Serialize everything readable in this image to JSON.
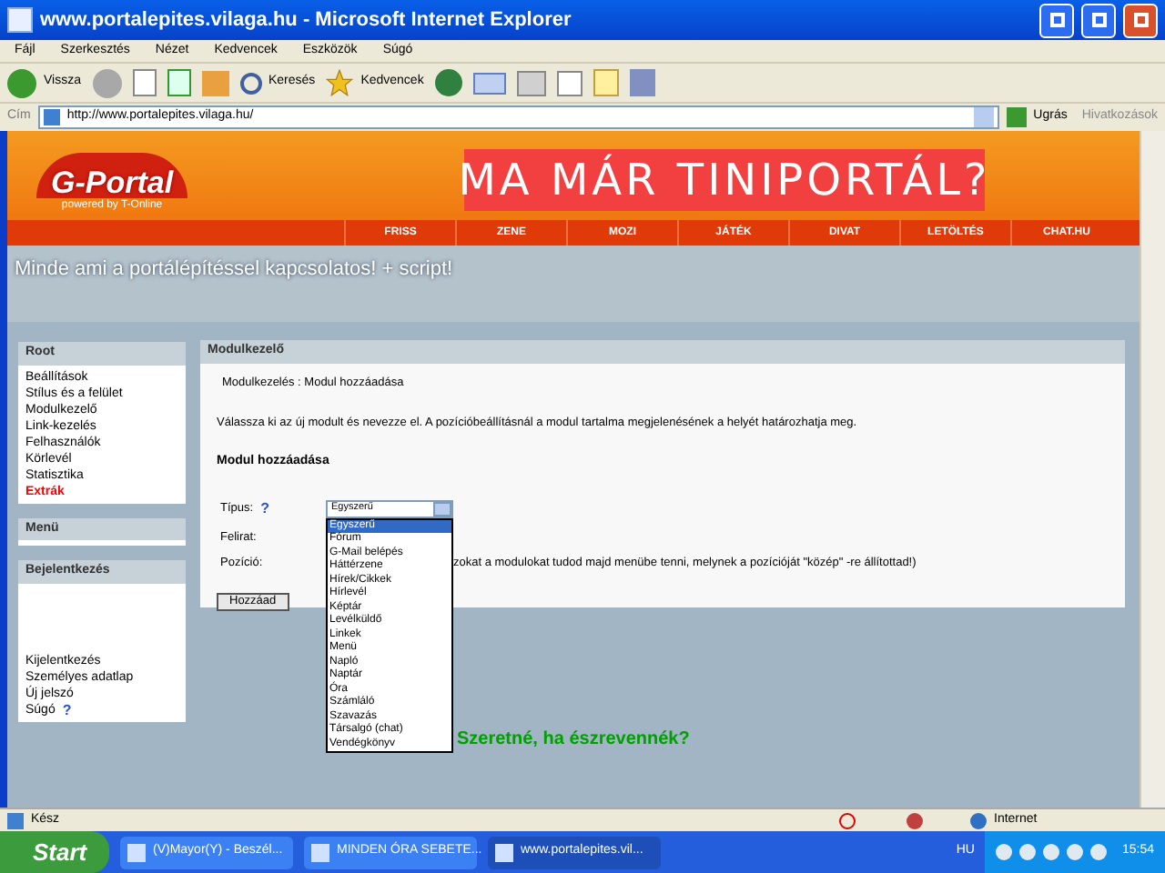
{
  "window": {
    "title": "www.portalepites.vilaga.hu - Microsoft Internet Explorer"
  },
  "menu": [
    "Fájl",
    "Szerkesztés",
    "Nézet",
    "Kedvencek",
    "Eszközök",
    "Súgó"
  ],
  "toolbar": {
    "back": "Vissza",
    "search": "Keresés",
    "favorites": "Kedvencek"
  },
  "address": {
    "label": "Cím",
    "value": "http://www.portalepites.vilaga.hu/",
    "go": "Ugrás",
    "links": "Hivatkozások"
  },
  "site": {
    "logo": "G-Portal",
    "logo_sub": "powered by T-Online",
    "banner": "MA MÁR TINIPORTÁL?",
    "nav": [
      "FRISS",
      "ZENE",
      "MOZI",
      "JÁTÉK",
      "DIVAT",
      "LETÖLTÉS",
      "CHAT.HU"
    ],
    "tagline": "Minde ami a portálépítéssel kapcsolatos! + script!"
  },
  "sidebar": [
    {
      "title": "Root",
      "items": [
        {
          "label": "Beállítások",
          "highlighted": false
        },
        {
          "label": "Stílus és a felület",
          "highlighted": false
        },
        {
          "label": "Modulkezelő",
          "highlighted": false
        },
        {
          "label": "Link-kezelés",
          "highlighted": false
        },
        {
          "label": "Felhasználók",
          "highlighted": false
        },
        {
          "label": "Körlevél",
          "highlighted": false
        },
        {
          "label": "Statisztika",
          "highlighted": false
        },
        {
          "label": "Extrák",
          "highlighted": true
        }
      ]
    },
    {
      "title": "Menü"
    },
    {
      "title": "Bejelentkezés",
      "items": [
        {
          "label": "Kijelentkezés",
          "highlighted": false
        },
        {
          "label": "Személyes adatlap",
          "highlighted": false
        },
        {
          "label": "Új jelszó",
          "highlighted": false
        },
        {
          "label": "Súgó",
          "highlighted": false,
          "help": "?"
        }
      ]
    }
  ],
  "panel": {
    "title": "Modulkezelő",
    "breadcrumb": "Modulkezelés : Modul hozzáadása",
    "intro": "Válassza ki az új modult és nevezze el. A pozícióbeállításnál a modul tartalma megjelenésének a helyét határozhatja meg.",
    "heading": "Modul hozzáadása",
    "type_label": "Típus:",
    "type_help": "?",
    "type_value": "Egyszerű",
    "caption_label": "Felirat:",
    "position_label": "Pozíció:",
    "position_note": "zokat a modulokat tudod majd menübe tenni, melynek a pozícióját \"közép\" -re állítottad!)",
    "submit": "Hozzáad",
    "options": [
      {
        "label": "Egyszerű",
        "selected": true
      },
      {
        "label": "Fórum",
        "selected": false
      },
      {
        "label": "G-Mail belépés",
        "selected": false
      },
      {
        "label": "Háttérzene",
        "selected": false
      },
      {
        "label": "Hírek/Cikkek",
        "selected": false
      },
      {
        "label": "Hírlevél",
        "selected": false
      },
      {
        "label": "Képtár",
        "selected": false
      },
      {
        "label": "Levélküldő",
        "selected": false
      },
      {
        "label": "Linkek",
        "selected": false
      },
      {
        "label": "Menü",
        "selected": false
      },
      {
        "label": "Napló",
        "selected": false
      },
      {
        "label": "Naptár",
        "selected": false
      },
      {
        "label": "Óra",
        "selected": false
      },
      {
        "label": "Számláló",
        "selected": false
      },
      {
        "label": "Szavazás",
        "selected": false
      },
      {
        "label": "Társalgó (chat)",
        "selected": false
      },
      {
        "label": "Vendégkönyv",
        "selected": false
      }
    ]
  },
  "promo": "Szeretné, ha észrevennék?",
  "status_bar": {
    "text": "Kész",
    "zone": "Internet"
  },
  "taskbar": {
    "start": "Start",
    "tasks": [
      {
        "label": "(V)Mayor(Y) - Beszél...",
        "selected": false
      },
      {
        "label": "MINDEN ÓRA SEBETE...",
        "selected": false
      },
      {
        "label": "www.portalepites.vil...",
        "selected": true
      }
    ],
    "lang": "HU",
    "clock": "15:54"
  }
}
